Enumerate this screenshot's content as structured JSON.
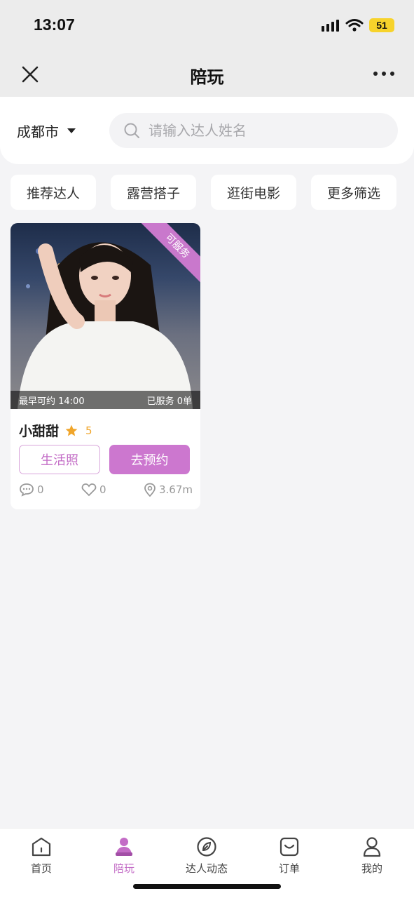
{
  "status": {
    "time": "13:07",
    "battery": "51"
  },
  "nav": {
    "title": "陪玩"
  },
  "search": {
    "city": "成都市",
    "placeholder": "请输入达人姓名"
  },
  "filters": [
    "推荐达人",
    "露营搭子",
    "逛街电影",
    "更多筛选"
  ],
  "card": {
    "ribbon": "可服务",
    "earliest": "最早可约 14:00",
    "served": "已服务 0单",
    "name": "小甜甜",
    "rating": "5",
    "photos_label": "生活照",
    "book_label": "去预约",
    "comments": "0",
    "likes": "0",
    "distance": "3.67m"
  },
  "tabs": [
    {
      "label": "首页",
      "icon": "home-icon"
    },
    {
      "label": "陪玩",
      "icon": "companion-icon"
    },
    {
      "label": "达人动态",
      "icon": "compass-icon"
    },
    {
      "label": "订单",
      "icon": "order-icon"
    },
    {
      "label": "我的",
      "icon": "profile-icon"
    }
  ],
  "colors": {
    "accent": "#cc77cf",
    "background": "#f4f4f6",
    "rating": "#f0a52a"
  }
}
